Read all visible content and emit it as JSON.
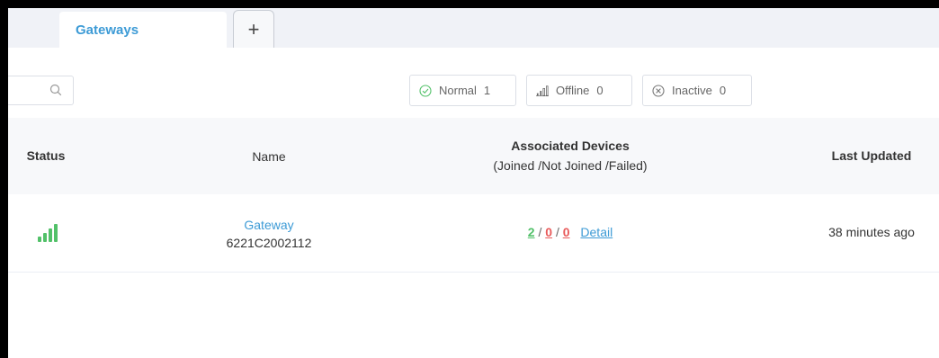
{
  "tabs": {
    "active_label": "Gateways",
    "add_label": "+"
  },
  "search": {
    "placeholder": ""
  },
  "filters": [
    {
      "label": "Normal",
      "count": "1",
      "icon": "check-circle-icon"
    },
    {
      "label": "Offline",
      "count": "0",
      "icon": "signal-icon"
    },
    {
      "label": "Inactive",
      "count": "0",
      "icon": "x-circle-icon"
    }
  ],
  "table": {
    "columns": {
      "status": "Status",
      "name": "Name",
      "devices_line1": "Associated Devices",
      "devices_line2": "(Joined /Not Joined /Failed)",
      "last_updated": "Last Updated"
    },
    "rows": [
      {
        "status_icon": "signal-bars-icon",
        "name": "Gateway",
        "serial": "6221C2002112",
        "joined": "2",
        "not_joined": "0",
        "failed": "0",
        "separator": "/",
        "detail_label": "Detail",
        "last_updated": "38 minutes ago"
      }
    ]
  },
  "colors": {
    "accent": "#3d9bd6",
    "ok": "#52c169",
    "error": "#e85a5a"
  }
}
